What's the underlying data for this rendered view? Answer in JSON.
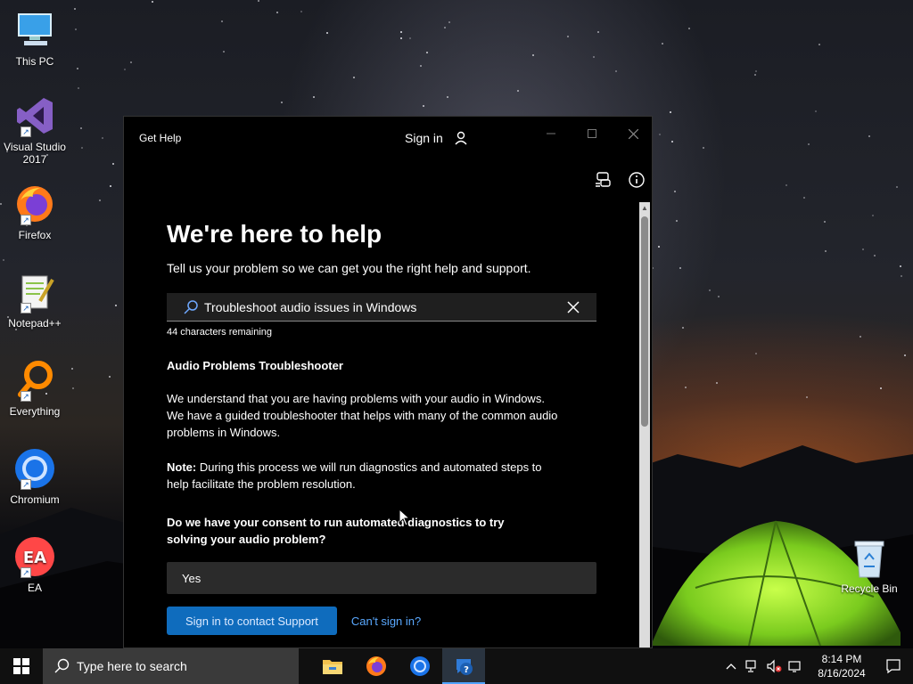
{
  "desktop": {
    "icons": [
      {
        "label": "This PC",
        "icon": "pc-icon"
      },
      {
        "label": "Visual Studio 2017",
        "icon": "visual-studio-icon"
      },
      {
        "label": "Firefox",
        "icon": "firefox-icon"
      },
      {
        "label": "Notepad++",
        "icon": "notepadpp-icon"
      },
      {
        "label": "Everything",
        "icon": "everything-icon"
      },
      {
        "label": "Chromium",
        "icon": "chromium-icon"
      },
      {
        "label": "EA",
        "icon": "ea-icon"
      }
    ],
    "recycle_bin": "Recycle Bin"
  },
  "window": {
    "title": "Get Help",
    "sign_in": "Sign in",
    "heading": "We're here to help",
    "subheading": "Tell us your problem so we can get you the right help and support.",
    "search": {
      "value": "Troubleshoot audio issues in Windows",
      "chars_remaining": "44 characters remaining"
    },
    "section_title": "Audio Problems Troubleshooter",
    "para1": "We understand that you are having problems with your audio in Windows. We have a guided troubleshooter that helps with many of the common audio problems in Windows.",
    "note_label": "Note:",
    "note_text": " During this process we will run diagnostics and automated steps to help facilitate the problem resolution.",
    "question": "Do we have your consent to run automated diagnostics to try solving your audio problem?",
    "option_yes": "Yes",
    "primary_button": "Sign in to contact Support",
    "link_button": "Can't sign in?"
  },
  "taskbar": {
    "search_placeholder": "Type here to search",
    "apps": [
      "file-explorer-icon",
      "firefox-icon",
      "chromium-icon",
      "get-help-icon"
    ],
    "time": "8:14 PM",
    "date": "8/16/2024"
  },
  "colors": {
    "accent": "#0f6cbd",
    "link": "#5aa9ff",
    "window_bg": "#000000",
    "input_bg": "#1f1f1f"
  }
}
